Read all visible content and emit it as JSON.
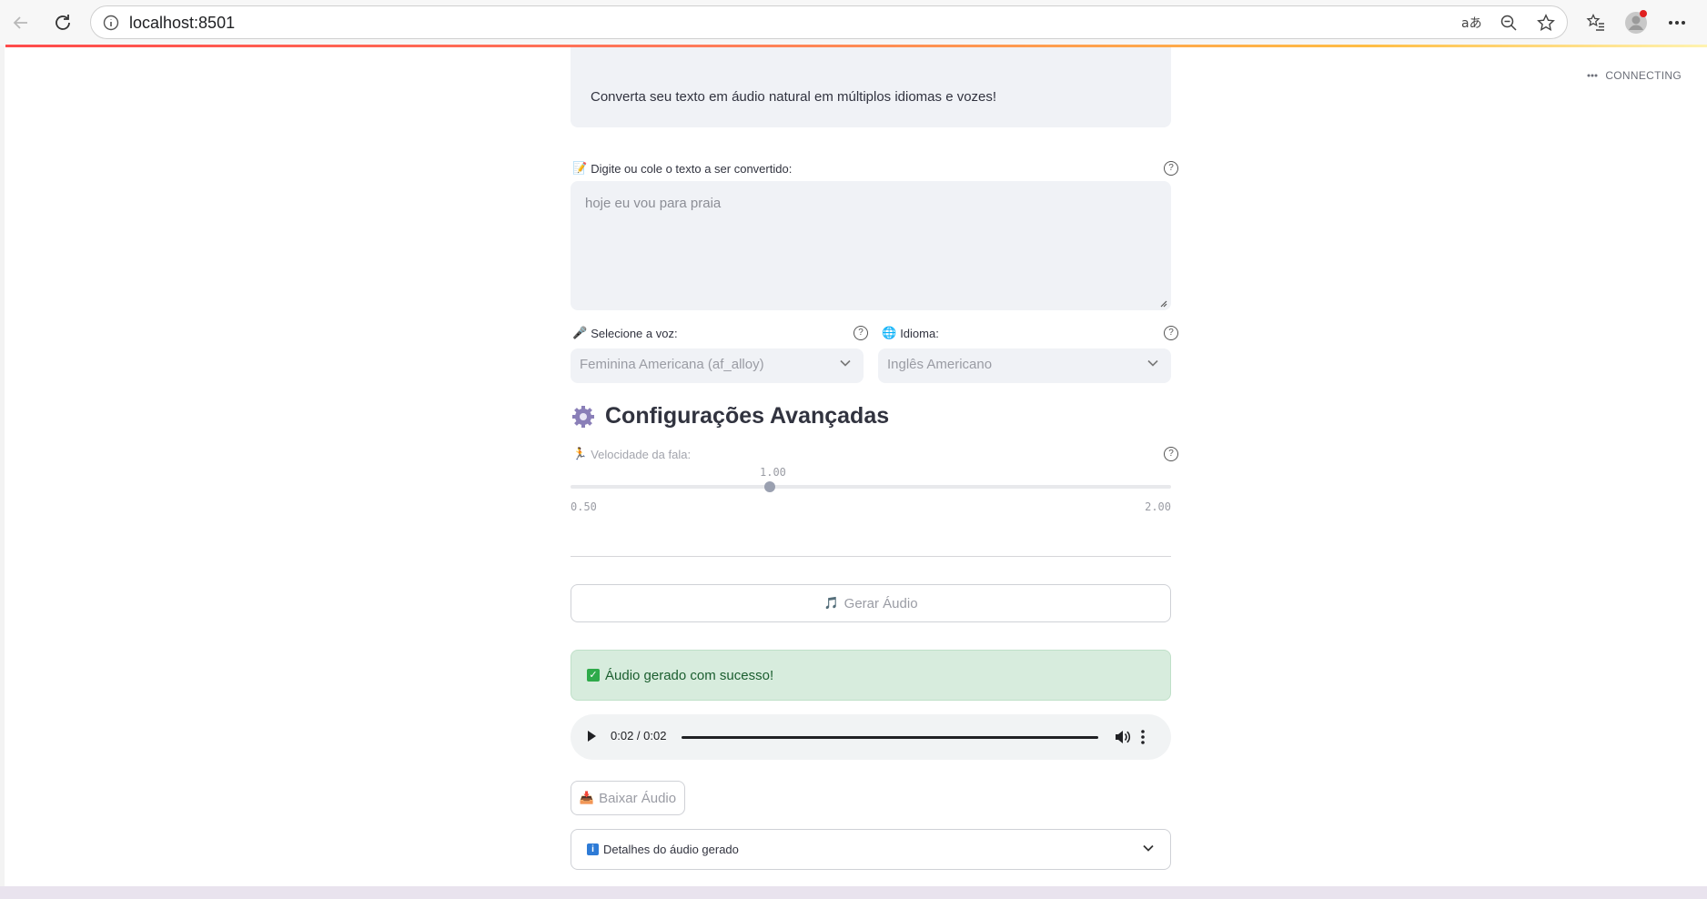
{
  "browser": {
    "url": "localhost:8501"
  },
  "status": {
    "connection": "CONNECTING"
  },
  "app": {
    "description": "Converta seu texto em áudio natural em múltiplos idiomas e vozes!",
    "text_input": {
      "label": "Digite ou cole o texto a ser convertido:",
      "placeholder": "hoje eu vou para praia",
      "icon": "memo-icon"
    },
    "voice_select": {
      "label": "Selecione a voz:",
      "value": "Feminina Americana (af_alloy)",
      "icon": "microphone-icon"
    },
    "language_select": {
      "label": "Idioma:",
      "value": "Inglês Americano",
      "icon": "globe-icon"
    },
    "advanced": {
      "title": "Configurações Avançadas",
      "icon": "gear-icon",
      "speed_label": "Velocidade da fala:",
      "speed_value": "1.00",
      "speed_min": "0.50",
      "speed_max": "2.00",
      "speed_fraction": 0.333
    },
    "generate_button": "Gerar Áudio",
    "success_message": "Áudio gerado com sucesso!",
    "audio_player": {
      "time": "0:02 / 0:02",
      "progress": 1.0
    },
    "download_button": "Baixar Áudio",
    "details_expander": "Detalhes do áudio gerado"
  },
  "colors": {
    "accent": "#ff4b4b",
    "success_bg": "#d7ecdd",
    "input_bg": "#f0f2f6"
  }
}
